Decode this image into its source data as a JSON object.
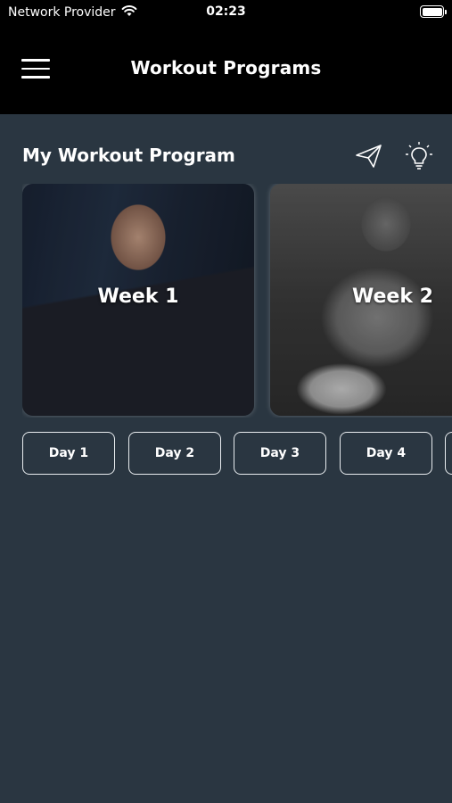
{
  "status_bar": {
    "carrier": "Network Provider",
    "time": "02:23",
    "battery_level": 100,
    "wifi_icon": "wifi-icon",
    "battery_icon": "battery-icon"
  },
  "header": {
    "title": "Workout Programs",
    "menu_icon": "hamburger-menu-icon"
  },
  "section": {
    "title": "My Workout Program",
    "actions": [
      {
        "icon": "paper-plane-icon"
      },
      {
        "icon": "lightbulb-icon"
      }
    ]
  },
  "weeks": [
    {
      "label": "Week 1"
    },
    {
      "label": "Week 2"
    }
  ],
  "days": [
    {
      "label": "Day 1"
    },
    {
      "label": "Day 2"
    },
    {
      "label": "Day 3"
    },
    {
      "label": "Day 4"
    },
    {
      "label": ""
    }
  ],
  "colors": {
    "background": "#2a3641",
    "header_background": "#000000",
    "text": "#ffffff",
    "pill_border": "#e8ecef"
  }
}
